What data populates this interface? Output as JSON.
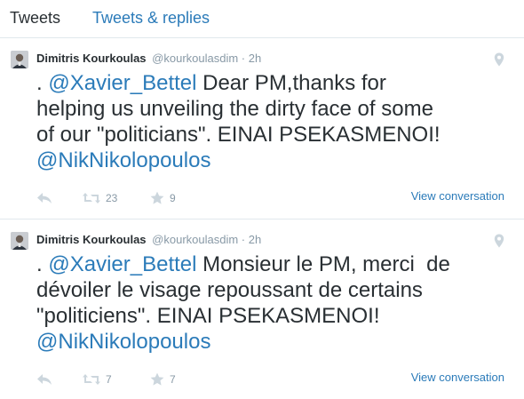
{
  "tabs": [
    {
      "label": "Tweets"
    },
    {
      "label": "Tweets & replies"
    }
  ],
  "tweets": [
    {
      "author_name": "Dimitris Kourkoulas",
      "handle": "@kourkoulasdim",
      "dot": "·",
      "time": "2h",
      "lines": [
        {
          "prefix": ". ",
          "mention": "@Xavier_Bettel",
          "rest": " Dear PM,thanks for"
        },
        {
          "text": "helping us unveiling the dirty face of some"
        },
        {
          "text": "of our \"politicians\". EINAI PSEKASMENOI!"
        },
        {
          "mention": "@NikNikolopoulos"
        }
      ],
      "retweets": "23",
      "favorites": "9",
      "view_conversation": "View conversation"
    },
    {
      "author_name": "Dimitris Kourkoulas",
      "handle": "@kourkoulasdim",
      "dot": "·",
      "time": "2h",
      "lines": [
        {
          "prefix": ". ",
          "mention": "@Xavier_Bettel",
          "rest": " Monsieur le PM, merci  de"
        },
        {
          "text": "dévoiler le visage repoussant de certains"
        },
        {
          "text": "\"politiciens\". EINAI PSEKASMENOI!"
        },
        {
          "mention": "@NikNikolopoulos"
        }
      ],
      "retweets": "7",
      "favorites": "7",
      "view_conversation": "View conversation"
    }
  ],
  "icons": {
    "avatar": "avatar",
    "location": "location-pin-icon",
    "reply": "reply-icon",
    "retweet": "retweet-icon",
    "favorite": "star-icon"
  },
  "colors": {
    "link": "#2b7bb9",
    "muted": "#8899a6",
    "text": "#292f33",
    "icon": "#ccd6dd"
  }
}
